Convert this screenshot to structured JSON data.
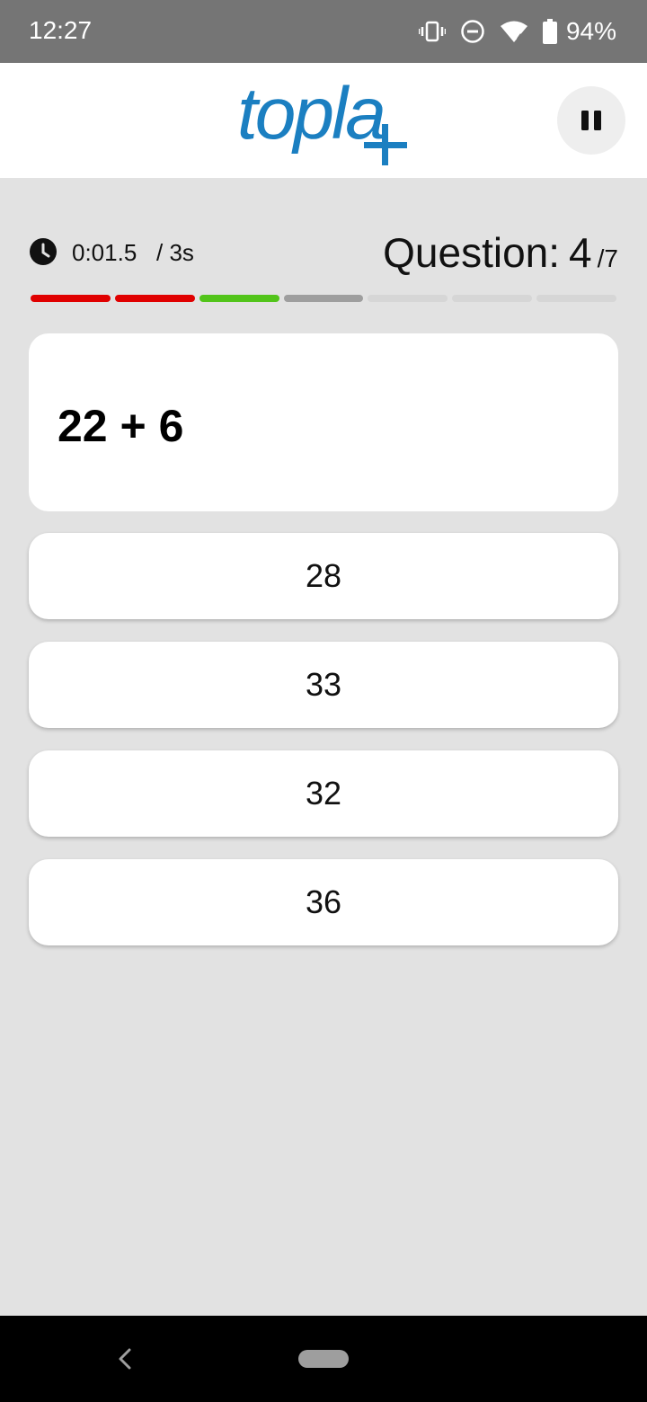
{
  "status_bar": {
    "time": "12:27",
    "battery": "94%",
    "icons": [
      "vibrate-icon",
      "do-not-disturb-icon",
      "wifi-icon",
      "battery-icon"
    ]
  },
  "header": {
    "logo_text": "topla",
    "logo_color": "#1b7fc1",
    "pause_icon": "pause-icon"
  },
  "timer": {
    "elapsed": "0:01.5",
    "limit": "/ 3s"
  },
  "question_counter": {
    "label": "Question:",
    "current": "4",
    "total": "/7"
  },
  "progress": {
    "segments": [
      {
        "status": "wrong",
        "color": "#e00000"
      },
      {
        "status": "wrong",
        "color": "#e00000"
      },
      {
        "status": "correct",
        "color": "#52c41a"
      },
      {
        "status": "current",
        "color": "#9e9e9e"
      },
      {
        "status": "pending",
        "color": "#d6d6d6"
      },
      {
        "status": "pending",
        "color": "#d6d6d6"
      },
      {
        "status": "pending",
        "color": "#d6d6d6"
      }
    ]
  },
  "question": {
    "text": "22 + 6"
  },
  "answers": [
    "28",
    "33",
    "32",
    "36"
  ]
}
